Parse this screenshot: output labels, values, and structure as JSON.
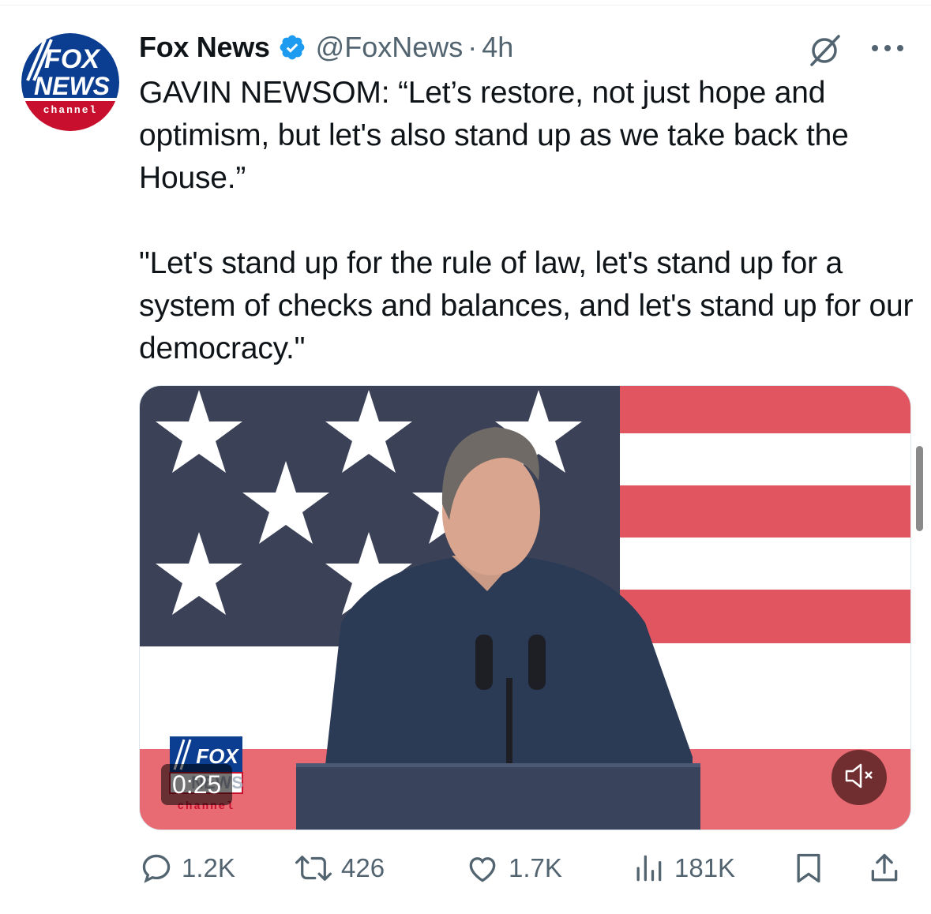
{
  "account": {
    "name": "Fox News",
    "handle": "@FoxNews",
    "separator": "·",
    "time": "4h",
    "avatar_logo_top": "FOX",
    "avatar_logo_mid": "NEWS",
    "avatar_logo_bottom": "channel"
  },
  "tweet": {
    "text": "GAVIN NEWSOM: “Let’s restore, not just hope and optimism, but let's also stand up as we take back the House.”\n\n\"Let's stand up for the rule of law, let's stand up for a system of checks and balances, and let's stand up for our democracy.\""
  },
  "video": {
    "duration": "0:25",
    "bug_top": "FOX",
    "bug_mid": "NEWS",
    "bug_bottom": "channel"
  },
  "actions": {
    "replies": "1.2K",
    "reposts": "426",
    "likes": "1.7K",
    "views": "181K"
  },
  "colors": {
    "verified": "#1d9bf0",
    "secondary_text": "#536471",
    "flag_red": "#e0555f",
    "flag_blue": "#3b4257"
  },
  "icons": [
    "verified-badge-icon",
    "grok-icon",
    "more-icon",
    "mute-icon",
    "reply-icon",
    "repost-icon",
    "like-icon",
    "views-icon",
    "bookmark-icon",
    "share-icon"
  ]
}
